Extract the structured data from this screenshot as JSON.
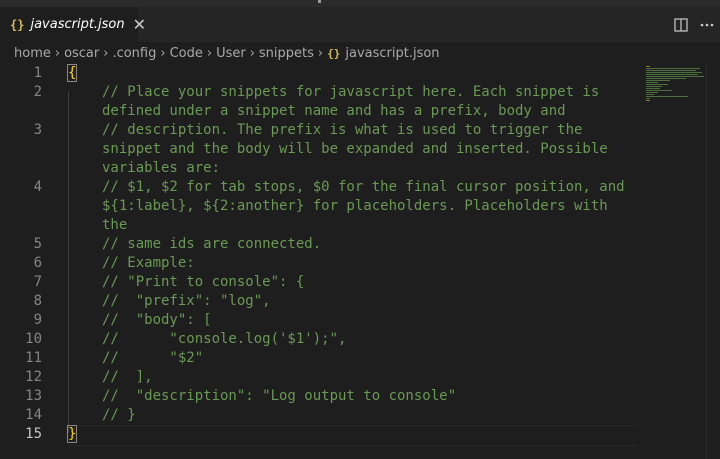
{
  "tab": {
    "icon": "{}",
    "title": "javascript.json",
    "close": "✕"
  },
  "actions": {
    "split_label": "split-editor-icon",
    "more_label": "more-actions-icon"
  },
  "breadcrumb": {
    "parts": [
      "home",
      "oscar",
      ".config",
      "Code",
      "User",
      "snippets"
    ],
    "file_icon": "{}",
    "file": "javascript.json",
    "separator": "›"
  },
  "editor": {
    "line_numbers": [
      "1",
      "2",
      "3",
      "4",
      "5",
      "6",
      "7",
      "8",
      "9",
      "10",
      "11",
      "12",
      "13",
      "14",
      "15"
    ],
    "lines": [
      "{",
      "// Place your snippets for javascript here. Each snippet is",
      "defined under a snippet name and has a prefix, body and",
      "// description. The prefix is what is used to trigger the",
      "snippet and the body will be expanded and inserted. Possible",
      "variables are:",
      "// $1, $2 for tab stops, $0 for the final cursor position, and",
      "${1:label}, ${2:another} for placeholders. Placeholders with",
      "the",
      "// same ids are connected.",
      "// Example:",
      "// \"Print to console\": {",
      "//  \"prefix\": \"log\",",
      "//  \"body\": [",
      "//      \"console.log('$1');\",",
      "//      \"$2\"",
      "//  ],",
      "//  \"description\": \"Log output to console\"",
      "// }",
      "}"
    ]
  },
  "colors": {
    "comment": "#6a9955",
    "brace": "#ffd700",
    "file_icon": "#d7ba5a",
    "background": "#1e1e1e"
  }
}
